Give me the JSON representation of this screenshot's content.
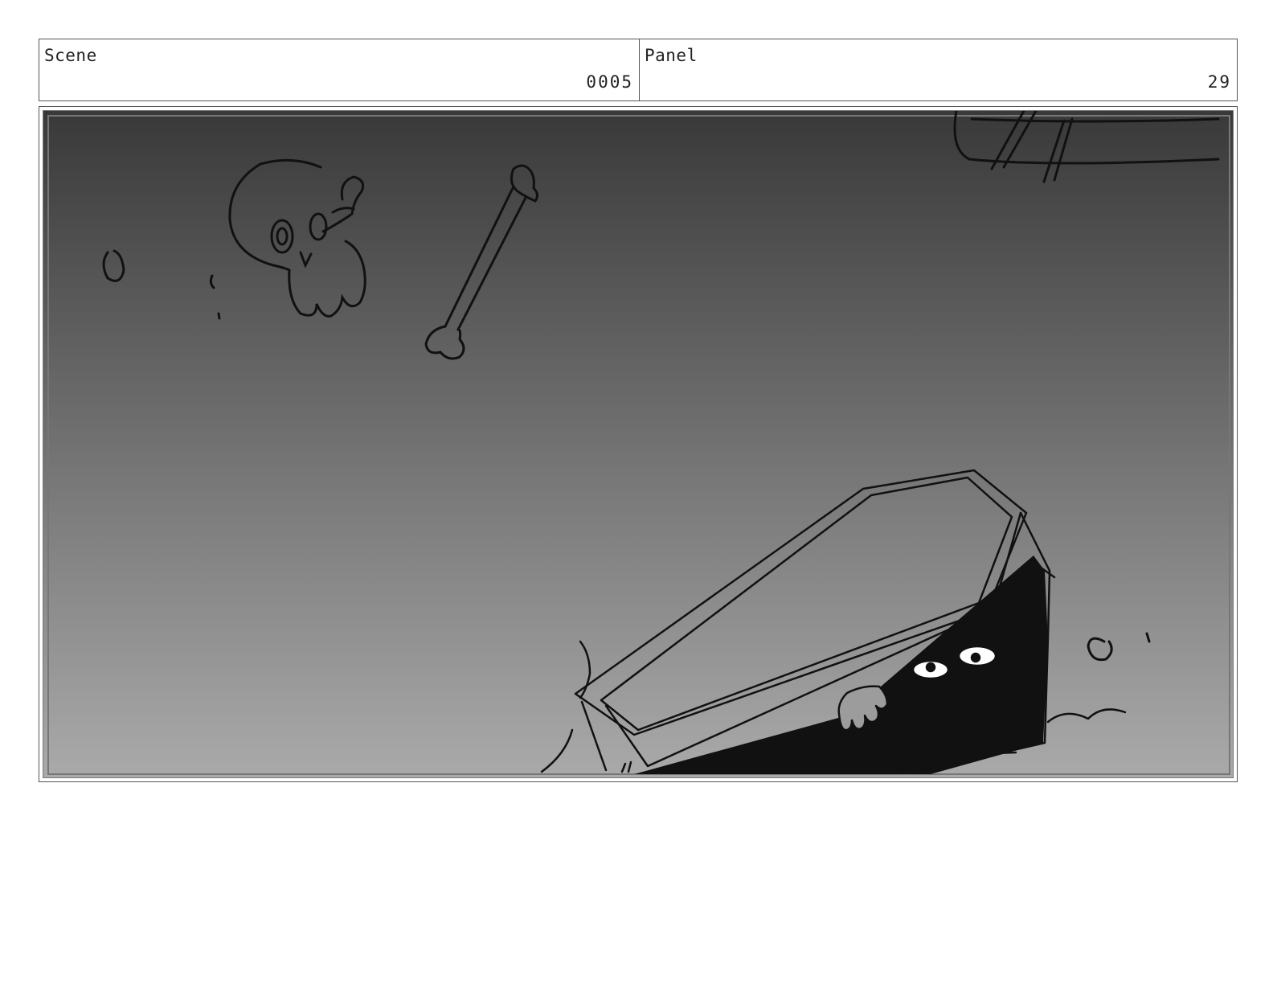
{
  "header": {
    "scene_label": "Scene",
    "scene_value": "0005",
    "panel_label": "Panel",
    "panel_value": "29"
  },
  "colors": {
    "gradient_top": "#393939",
    "gradient_bottom": "#aaaaaa",
    "ink": "#111111"
  }
}
